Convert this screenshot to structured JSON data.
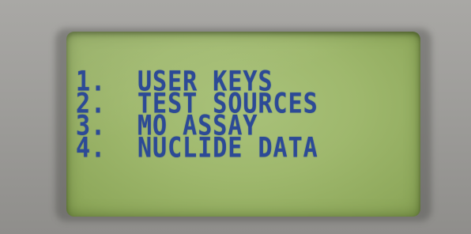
{
  "menu": {
    "items": [
      {
        "number": "1.",
        "label": "USER KEYS"
      },
      {
        "number": "2.",
        "label": "TEST SOURCES"
      },
      {
        "number": "3.",
        "label": "MO ASSAY"
      },
      {
        "number": "4.",
        "label": "NUCLIDE DATA"
      }
    ]
  },
  "colors": {
    "lcd_background": "#9fb86d",
    "lcd_text": "#2c4a96",
    "bezel": "#9e9d9a"
  }
}
